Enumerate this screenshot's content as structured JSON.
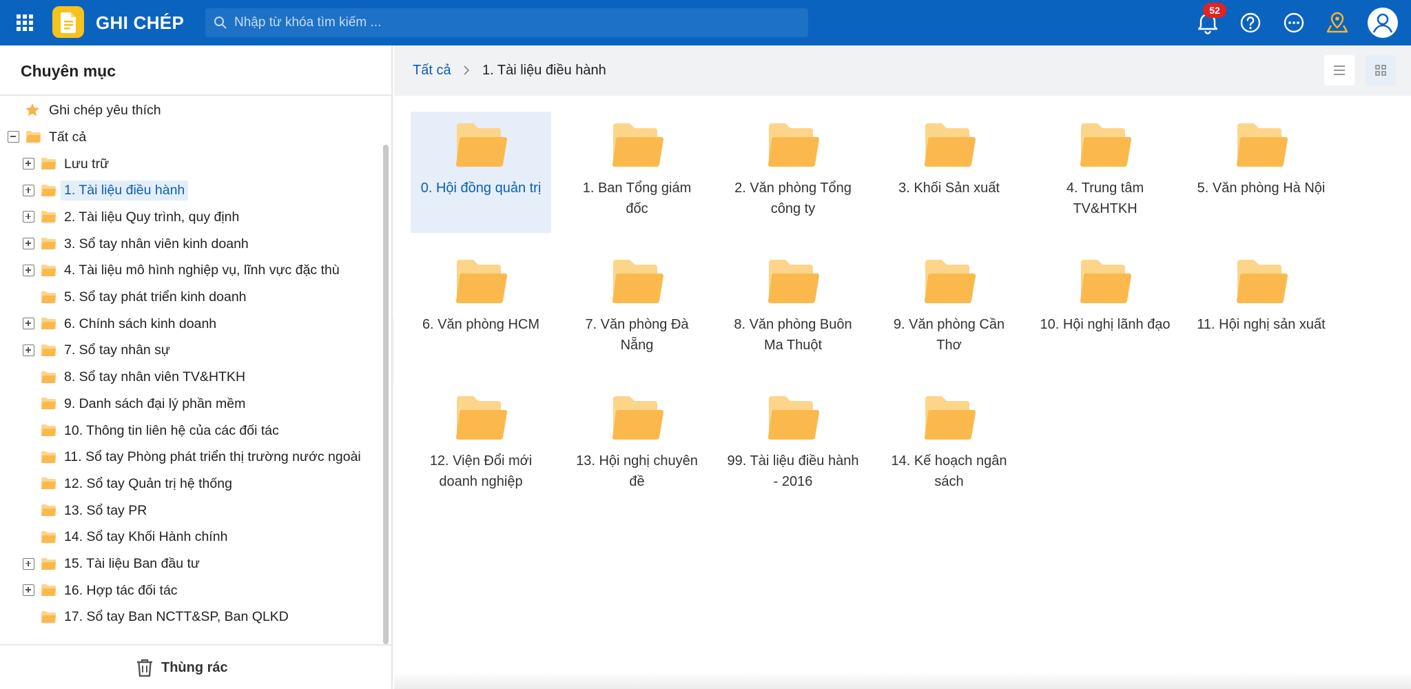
{
  "header": {
    "app_title": "GHI CHÉP",
    "search_placeholder": "Nhập từ khóa tìm kiếm ...",
    "notification_count": "52",
    "icons": [
      "apps-grid-icon",
      "note-logo-icon",
      "search-icon",
      "bell-icon",
      "help-icon",
      "more-icon",
      "location-icon",
      "user-avatar-icon"
    ],
    "colors": {
      "bar": "#0b63c0",
      "logo": "#f6c21b",
      "badge": "#e32222"
    }
  },
  "sidebar": {
    "title": "Chuyên mục",
    "favorites": "Ghi chép yêu thích",
    "root": "Tất cả",
    "items": [
      {
        "label": "Lưu trữ",
        "expandable": true
      },
      {
        "label": "1. Tài liệu điều hành",
        "expandable": true,
        "selected": true
      },
      {
        "label": "2. Tài liệu Quy trình, quy định",
        "expandable": true
      },
      {
        "label": "3. Sổ tay nhân viên kinh doanh",
        "expandable": true
      },
      {
        "label": "4. Tài liệu mô hình nghiệp vụ, lĩnh vực đặc thù",
        "expandable": true
      },
      {
        "label": "5. Sổ tay phát triển kinh doanh",
        "expandable": false
      },
      {
        "label": "6. Chính sách kinh doanh",
        "expandable": true
      },
      {
        "label": "7. Sổ tay nhân sự",
        "expandable": true
      },
      {
        "label": "8. Sổ tay nhân viên TV&HTKH",
        "expandable": false
      },
      {
        "label": "9. Danh sách đại lý phần mềm",
        "expandable": false
      },
      {
        "label": "10. Thông tin liên hệ của các đối tác",
        "expandable": false
      },
      {
        "label": "11. Sổ tay Phòng phát triển thị trường nước ngoài",
        "expandable": false
      },
      {
        "label": "12. Sổ tay Quản trị hệ thống",
        "expandable": false
      },
      {
        "label": "13. Sổ tay PR",
        "expandable": false
      },
      {
        "label": "14. Sổ tay Khối Hành chính",
        "expandable": false
      },
      {
        "label": "15. Tài liệu Ban đầu tư",
        "expandable": true
      },
      {
        "label": "16. Hợp tác đối tác",
        "expandable": true
      },
      {
        "label": "17. Sổ tay Ban NCTT&SP, Ban QLKD",
        "expandable": false
      }
    ],
    "trash_label": "Thùng rác"
  },
  "breadcrumb": {
    "root": "Tất cả",
    "current": "1. Tài liệu điều hành"
  },
  "view": {
    "mode": "grid",
    "buttons": [
      "list-view-icon",
      "grid-view-icon"
    ]
  },
  "folders": [
    {
      "label": "0. Hội đồng quản trị",
      "selected": true
    },
    {
      "label": "1. Ban Tổng giám đốc"
    },
    {
      "label": "2. Văn phòng Tổng công ty"
    },
    {
      "label": "3. Khối Sản xuất"
    },
    {
      "label": "4. Trung tâm TV&HTKH"
    },
    {
      "label": "5. Văn phòng Hà Nội"
    },
    {
      "label": "6. Văn phòng HCM"
    },
    {
      "label": "7. Văn phòng Đà Nẵng"
    },
    {
      "label": "8. Văn phòng Buôn Ma Thuột"
    },
    {
      "label": "9. Văn phòng Cần Thơ"
    },
    {
      "label": "10. Hội nghị lãnh đạo"
    },
    {
      "label": "11. Hội nghị sản xuất"
    },
    {
      "label": "12. Viện Đổi mới doanh nghiệp"
    },
    {
      "label": "13. Hội nghị chuyên đề"
    },
    {
      "label": "99. Tài liệu điều hành - 2016"
    },
    {
      "label": "14. Kế hoạch ngân sách"
    }
  ],
  "colors": {
    "folder": "#fbb94d",
    "folder_back": "#fdd58a",
    "accent": "#0b5fb5",
    "selection": "#e6eef9"
  }
}
